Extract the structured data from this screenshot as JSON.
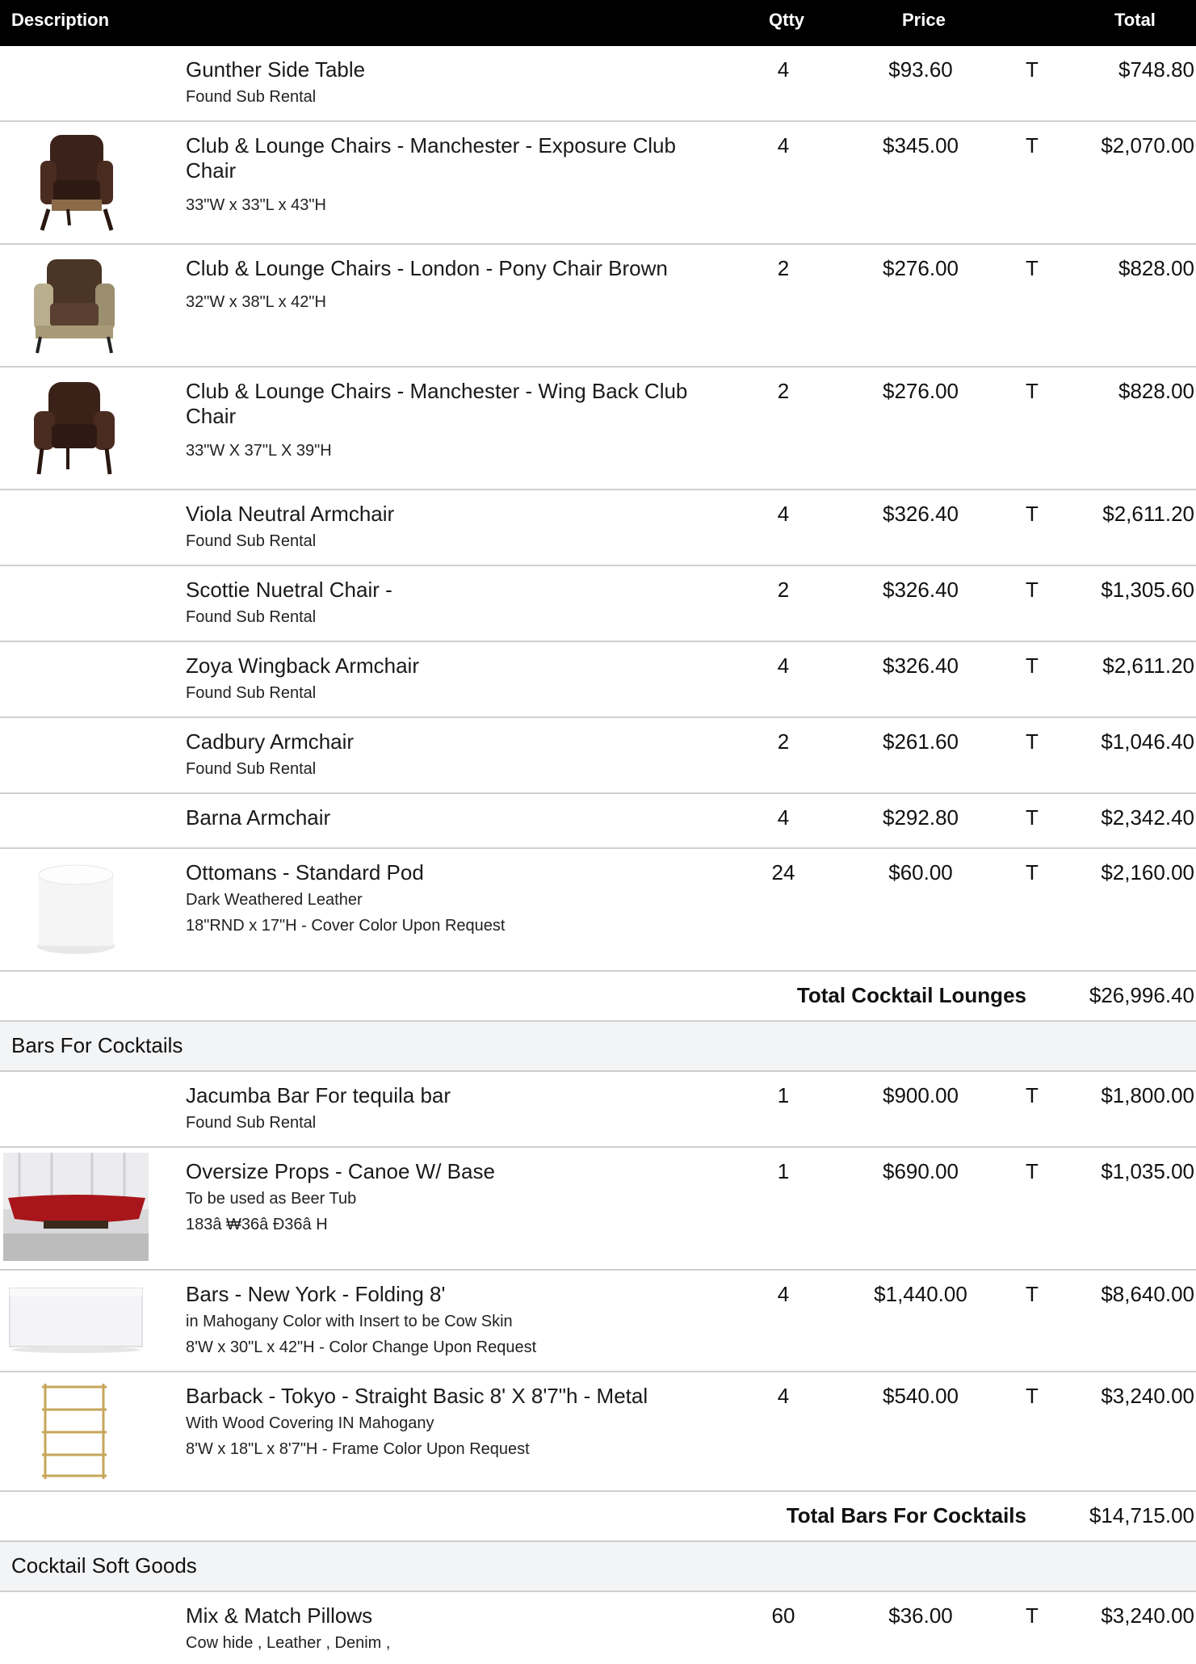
{
  "header": {
    "description": "Description",
    "qty": "Qtty",
    "price": "Price",
    "total": "Total"
  },
  "rows1": [
    {
      "title": "Gunther Side Table",
      "subs": [
        "Found Sub Rental"
      ],
      "qty": "4",
      "price": "$93.60",
      "tax": "T",
      "total": "$748.80"
    },
    {
      "title": "Club & Lounge Chairs - Manchester - Exposure Club Chair",
      "subs": [
        "33\"W x 33\"L x 43\"H"
      ],
      "qty": "4",
      "price": "$345.00",
      "tax": "T",
      "total": "$2,070.00",
      "icon": "leather-club-chair-photo"
    },
    {
      "title": "Club & Lounge Chairs - London - Pony Chair Brown",
      "subs": [
        "32\"W x 38\"L x 42\"H"
      ],
      "qty": "2",
      "price": "$276.00",
      "tax": "T",
      "total": "$828.00",
      "icon": "pony-chair-photo"
    },
    {
      "title": "Club & Lounge Chairs - Manchester - Wing Back Club Chair",
      "subs": [
        "33\"W X 37\"L X 39\"H"
      ],
      "qty": "2",
      "price": "$276.00",
      "tax": "T",
      "total": "$828.00",
      "icon": "wing-back-chair-photo"
    },
    {
      "title": "Viola Neutral Armchair",
      "subs": [
        "Found Sub Rental"
      ],
      "qty": "4",
      "price": "$326.40",
      "tax": "T",
      "total": "$2,611.20"
    },
    {
      "title": "Scottie Nuetral Chair -",
      "subs": [
        "Found Sub Rental"
      ],
      "qty": "2",
      "price": "$326.40",
      "tax": "T",
      "total": "$1,305.60"
    },
    {
      "title": "Zoya Wingback Armchair",
      "subs": [
        "Found Sub Rental"
      ],
      "qty": "4",
      "price": "$326.40",
      "tax": "T",
      "total": "$2,611.20"
    },
    {
      "title": "Cadbury Armchair",
      "subs": [
        "Found Sub Rental"
      ],
      "qty": "2",
      "price": "$261.60",
      "tax": "T",
      "total": "$1,046.40"
    },
    {
      "title": "Barna Armchair",
      "subs": [],
      "qty": "4",
      "price": "$292.80",
      "tax": "T",
      "total": "$2,342.40"
    },
    {
      "title": "Ottomans - Standard Pod",
      "subs": [
        "Dark Weathered Leather",
        "18\"RND x 17\"H - Cover Color Upon Request"
      ],
      "qty": "24",
      "price": "$60.00",
      "tax": "T",
      "total": "$2,160.00",
      "icon": "white-pod-ottoman-photo"
    }
  ],
  "total1": {
    "label": "Total Cocktail Lounges",
    "value": "$26,996.40"
  },
  "section2": "Bars For Cocktails",
  "rows2": [
    {
      "title": "Jacumba Bar For tequila bar",
      "subs": [
        "Found Sub Rental"
      ],
      "qty": "1",
      "price": "$900.00",
      "tax": "T",
      "total": "$1,800.00"
    },
    {
      "title": "Oversize Props - Canoe W/ Base",
      "subs": [
        "To be used as Beer Tub",
        "183â  ₩36â  Ð36â  H"
      ],
      "qty": "1",
      "price": "$690.00",
      "tax": "T",
      "total": "$1,035.00",
      "icon": "red-canoe-photo"
    },
    {
      "title": "Bars - New York -  Folding 8'",
      "subs": [
        "in Mahogany Color with Insert to be Cow Skin",
        "8'W x 30\"L x 42\"H - Color Change Upon Request"
      ],
      "qty": "4",
      "price": "$1,440.00",
      "tax": "T",
      "total": "$8,640.00",
      "icon": "white-bar-photo"
    },
    {
      "title": "Barback - Tokyo - Straight Basic 8' X 8'7\"h - Metal",
      "subs": [
        "With Wood Covering IN Mahogany",
        "8'W x 18\"L x 8'7\"H - Frame Color Upon Request"
      ],
      "qty": "4",
      "price": "$540.00",
      "tax": "T",
      "total": "$3,240.00",
      "icon": "gold-shelf-photo"
    }
  ],
  "total2": {
    "label": "Total Bars For Cocktails",
    "value": "$14,715.00"
  },
  "section3": "Cocktail Soft Goods",
  "rows3": [
    {
      "title": "Mix & Match Pillows",
      "subs": [
        "Cow hide , Leather , Denim ,"
      ],
      "qty": "60",
      "price": "$36.00",
      "tax": "T",
      "total": "$3,240.00"
    }
  ]
}
